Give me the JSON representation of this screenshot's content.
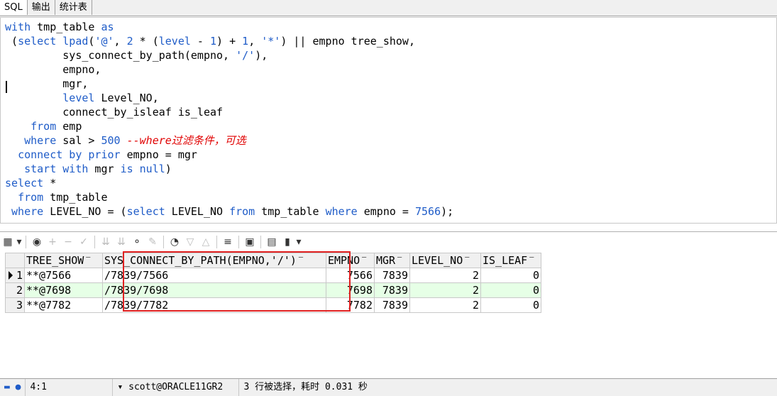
{
  "tabs": [
    "SQL",
    "输出",
    "统计表"
  ],
  "grid": {
    "columns": [
      "TREE_SHOW",
      "SYS_CONNECT_BY_PATH(EMPNO,'/')",
      "EMPNO",
      "MGR",
      "LEVEL_NO",
      "IS_LEAF"
    ],
    "rows": [
      {
        "num": "1",
        "tree_show": "**@7566",
        "path": "/7839/7566",
        "empno": "7566",
        "mgr": "7839",
        "level_no": "2",
        "is_leaf": "0"
      },
      {
        "num": "2",
        "tree_show": "**@7698",
        "path": "/7839/7698",
        "empno": "7698",
        "mgr": "7839",
        "level_no": "2",
        "is_leaf": "0"
      },
      {
        "num": "3",
        "tree_show": "**@7782",
        "path": "/7839/7782",
        "empno": "7782",
        "mgr": "7839",
        "level_no": "2",
        "is_leaf": "0"
      }
    ],
    "selected_row": "2"
  },
  "status": {
    "cursor": "4:1",
    "connection": "scott@ORACLE11GR2",
    "message": "3 行被选择，耗时 0.031 秒"
  },
  "colors": {
    "keyword": "#1f5cc8",
    "comment": "#e00000",
    "highlight_box": "#e02020",
    "selected_row": "#e6ffe6"
  }
}
